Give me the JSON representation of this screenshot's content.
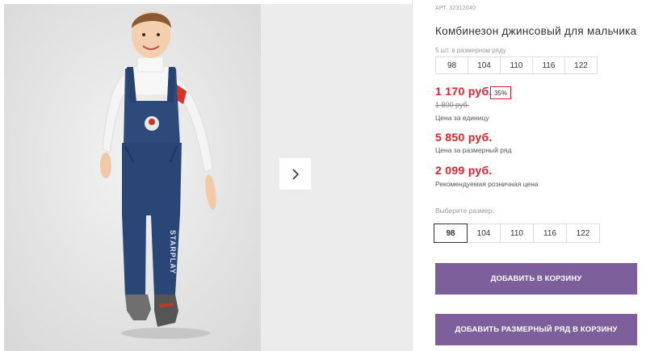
{
  "product": {
    "article": "АРТ. 32312040",
    "title": "Комбинезон джинсовый для мальчика",
    "series_label": "5 шт. в размерном ряду",
    "series_sizes": [
      "98",
      "104",
      "110",
      "116",
      "122"
    ],
    "price_unit": "1 170 руб.",
    "discount": "35%",
    "price_old": "1 800 руб.",
    "price_unit_note": "Цена за единицу",
    "price_series": "5 850 руб.",
    "price_series_note": "Цена за размерный ряд",
    "price_retail": "2 099 руб.",
    "price_retail_note": "Рекомендуемая розничная цена",
    "choose_size_label": "Выберите размер:",
    "sizes": [
      "98",
      "104",
      "110",
      "116",
      "122"
    ],
    "selected_size": "98"
  },
  "gallery": {
    "overall_text": "STARPLAY"
  },
  "actions": {
    "add_to_cart": "ДОБАВИТЬ В КОРЗИНУ",
    "add_series_to_cart": "ДОБАВИТЬ РАЗМЕРНЫЙ РЯД В КОРЗИНУ"
  },
  "colors": {
    "price": "#e01e2d",
    "button": "#7d5f9b"
  },
  "icons": {
    "next": "chevron-right-icon"
  }
}
